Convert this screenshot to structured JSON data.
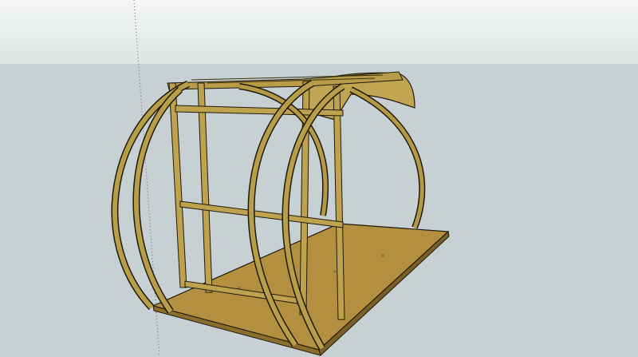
{
  "viewport": {
    "sky_color": "#e8ebec",
    "ground_color": "#c7d1d3",
    "model": "arched-hut-frame",
    "wood_color": "#b59a42",
    "floor_color": "#b89545",
    "edge_color": "#1e1a0c"
  }
}
